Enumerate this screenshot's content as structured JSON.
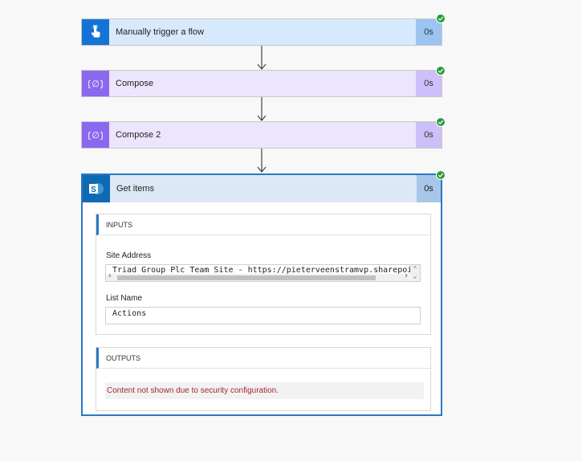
{
  "steps": [
    {
      "title": "Manually trigger a flow",
      "duration": "0s",
      "icon": "touch-icon",
      "status": "success"
    },
    {
      "title": "Compose",
      "duration": "0s",
      "icon": "compose-icon",
      "status": "success"
    },
    {
      "title": "Compose 2",
      "duration": "0s",
      "icon": "compose-icon",
      "status": "success"
    }
  ],
  "get_items": {
    "title": "Get items",
    "duration": "0s",
    "icon": "sharepoint-icon",
    "inputs_label": "INPUTS",
    "site_address_label": "Site Address",
    "site_address_value": "Triad Group Plc Team Site - https://pieterveenstramvp.sharepoint.c",
    "list_name_label": "List Name",
    "list_name_value": "Actions",
    "outputs_label": "OUTPUTS",
    "outputs_message": "Content not shown due to security configuration."
  },
  "colors": {
    "trigger_accent": "#1374d6",
    "compose_accent": "#8b69ee",
    "sharepoint_accent": "#0f6ab4",
    "success": "#2a9c3f",
    "error_text": "#a4262c"
  }
}
